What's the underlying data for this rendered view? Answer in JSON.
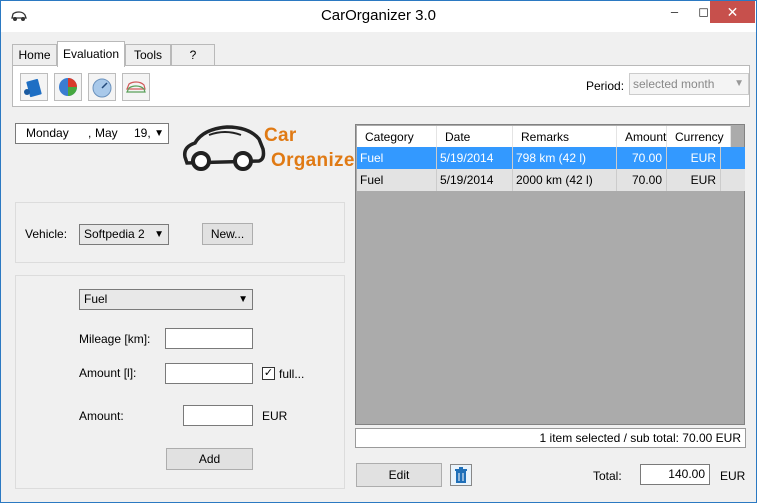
{
  "window": {
    "title": "CarOrganizer 3.0"
  },
  "tabs": [
    {
      "label": "Home"
    },
    {
      "label": "Evaluation"
    },
    {
      "label": "Tools"
    },
    {
      "label": "?"
    }
  ],
  "toolbar": {
    "icons": [
      "fuel-icon",
      "pie-chart-icon",
      "speedometer-icon",
      "car-compare-icon"
    ],
    "period_label": "Period:",
    "period_value": "selected month"
  },
  "date": {
    "day_name": "Monday",
    "sep": ",",
    "month": "May",
    "day": "19,",
    "dropdown_icon": "chevron-down-icon"
  },
  "logo": {
    "line1": "Car",
    "line2": "Organizer"
  },
  "vehicle": {
    "label": "Vehicle:",
    "value": "Softpedia 2",
    "new_button": "New..."
  },
  "entry": {
    "category": "Fuel",
    "mileage_label": "Mileage [km]:",
    "mileage_value": "",
    "amount_l_label": "Amount [l]:",
    "amount_l_value": "",
    "full_label": "full...",
    "full_checked": true,
    "amount_label": "Amount:",
    "amount_value": "",
    "currency": "EUR",
    "add_button": "Add"
  },
  "table": {
    "columns": [
      "Category",
      "Date",
      "Remarks",
      "Amount",
      "Currency"
    ],
    "rows": [
      {
        "category": "Fuel",
        "date": "5/19/2014",
        "remarks": "798 km (42 l)",
        "amount": "70.00",
        "currency": "EUR",
        "selected": true
      },
      {
        "category": "Fuel",
        "date": "5/19/2014",
        "remarks": "2000 km (42 l)",
        "amount": "70.00",
        "currency": "EUR",
        "selected": false
      }
    ]
  },
  "status": {
    "text": "1 item selected   /  sub total: 70.00 EUR"
  },
  "footer": {
    "edit_button": "Edit",
    "total_label": "Total:",
    "total_value": "140.00",
    "currency": "EUR"
  }
}
